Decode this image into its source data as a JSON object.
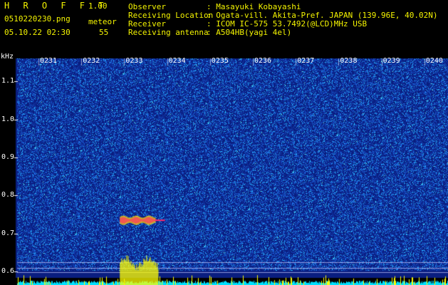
{
  "app": {
    "title": "H R O F F T",
    "version": "1.00",
    "file_name": "0510220230.png",
    "date_time": "05.10.22 02:30",
    "meteor_label": "meteor",
    "meteor_count": "55"
  },
  "info": [
    {
      "label": "Observer",
      "value": ": Masayuki Kobayashi"
    },
    {
      "label": "Receiving Location",
      "value": ": Ogata-vill. Akita-Pref. JAPAN (139.96E, 40.02N)"
    },
    {
      "label": "Receiver",
      "value": ": ICOM IC-575 53.7492(@LCD)MHz USB"
    },
    {
      "label": "Receiving antenna",
      "value": ": A504HB(yagi 4el)"
    }
  ],
  "spectrogram": {
    "freq_unit": "kHz",
    "freq_ticks": [
      "1.1",
      "1.0",
      "0.9",
      "0.8",
      "0.7",
      "0.6"
    ],
    "freq_tick_values": [
      1.1,
      1.0,
      0.9,
      0.8,
      0.7,
      0.6
    ],
    "freq_range": [
      0.58,
      1.16
    ],
    "time_labels": [
      "0231",
      "0232",
      "0233",
      "0234",
      "0235",
      "0236",
      "0237",
      "0238",
      "0239",
      "0240"
    ],
    "meteor_echo": {
      "start_minute": 2.0,
      "end_minute": 2.85,
      "freq_khz": 0.735
    },
    "colors": {
      "background": "#0a1e80",
      "noise": "#1e6ae0",
      "echo_core": "#ff2a6e",
      "echo_edge": "#ffd400",
      "power_trace": "#ffff00",
      "baseline": "#00e0ff",
      "text_header": "#f4f400"
    }
  }
}
